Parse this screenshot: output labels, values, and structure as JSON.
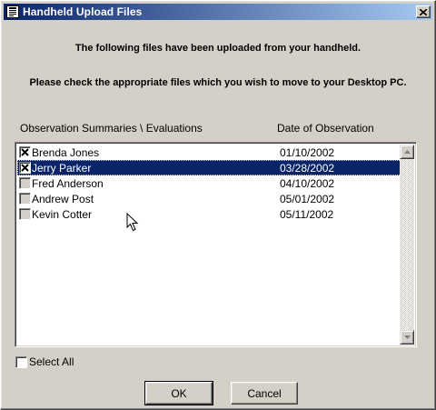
{
  "window": {
    "title": "Handheld Upload Files",
    "icon": "app-icon",
    "close_icon": "close-icon"
  },
  "messages": {
    "line1": "The following files have been uploaded from your handheld.",
    "line2": "Please check the appropriate files which you wish to move to your Desktop PC."
  },
  "list": {
    "headers": {
      "name": "Observation Summaries \\ Evaluations",
      "date": "Date of Observation"
    },
    "rows": [
      {
        "name": "Brenda Jones",
        "date": "01/10/2002",
        "checked": true,
        "selected": false
      },
      {
        "name": "Jerry Parker",
        "date": "03/28/2002",
        "checked": true,
        "selected": true
      },
      {
        "name": "Fred Anderson",
        "date": "04/10/2002",
        "checked": false,
        "selected": false
      },
      {
        "name": "Andrew Post",
        "date": "05/01/2002",
        "checked": false,
        "selected": false
      },
      {
        "name": "Kevin Cotter",
        "date": "05/11/2002",
        "checked": false,
        "selected": false
      }
    ]
  },
  "select_all": {
    "label": "Select All",
    "checked": false
  },
  "buttons": {
    "ok": "OK",
    "cancel": "Cancel"
  },
  "colors": {
    "face": "#d4d0c8",
    "title_start": "#0a246a",
    "title_end": "#a6caf0",
    "selection": "#0a246a"
  }
}
